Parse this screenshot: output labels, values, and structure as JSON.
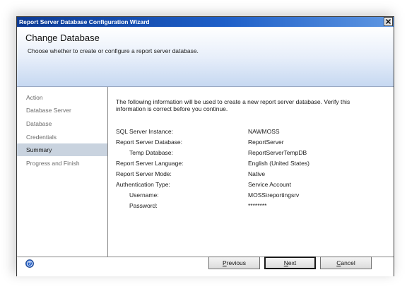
{
  "window": {
    "title": "Report Server Database Configuration Wizard"
  },
  "header": {
    "title": "Change Database",
    "subtitle": "Choose whether to create or configure a report server database."
  },
  "nav": {
    "items": [
      {
        "label": "Action",
        "active": false
      },
      {
        "label": "Database Server",
        "active": false
      },
      {
        "label": "Database",
        "active": false
      },
      {
        "label": "Credentials",
        "active": false
      },
      {
        "label": "Summary",
        "active": true
      },
      {
        "label": "Progress and Finish",
        "active": false
      }
    ]
  },
  "summary": {
    "intro": "The following information will be used to create a new report server database. Verify this information is correct before you continue.",
    "rows": [
      {
        "label": "SQL Server Instance:",
        "value": "NAWMOSS"
      },
      {
        "label": "Report Server Database:",
        "value": "ReportServer"
      },
      {
        "label": "Temp Database:",
        "value": "ReportServerTempDB"
      },
      {
        "label": "Report Server Language:",
        "value": "English (United States)"
      },
      {
        "label": "Report Server Mode:",
        "value": "Native"
      },
      {
        "label": "Authentication Type:",
        "value": "Service Account"
      },
      {
        "label": "Username:",
        "value": "MOSS\\reportingsrv"
      },
      {
        "label": "Password:",
        "value": "********"
      }
    ]
  },
  "buttons": {
    "previous_pre": "",
    "previous_u": "P",
    "previous_post": "revious",
    "next_pre": "",
    "next_u": "N",
    "next_post": "ext",
    "cancel_pre": "",
    "cancel_u": "C",
    "cancel_post": "ancel"
  },
  "icons": {
    "help": "help-icon",
    "close": "close-icon"
  }
}
